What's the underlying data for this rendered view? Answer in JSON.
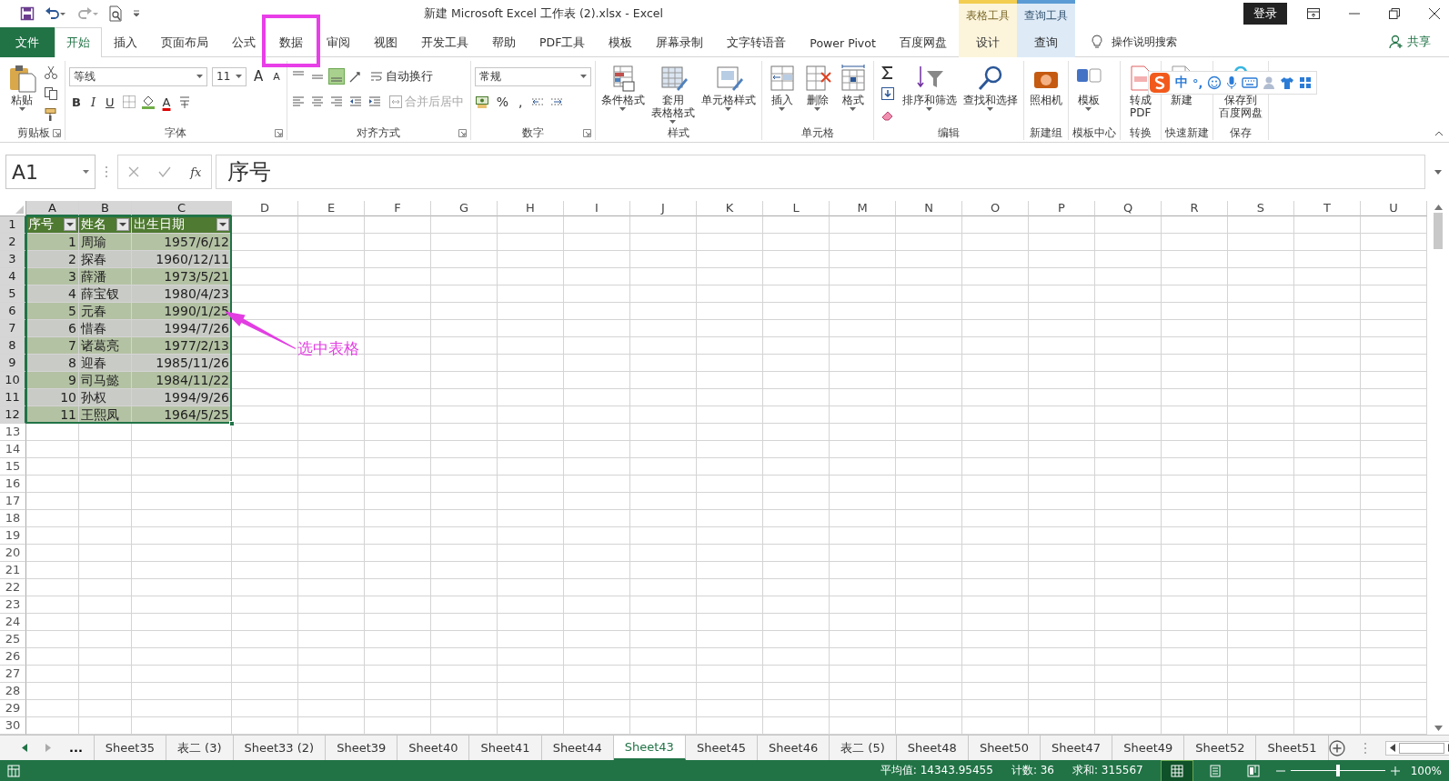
{
  "title_bar": {
    "title": "新建 Microsoft Excel 工作表 (2).xlsx  -  Excel",
    "context_headers": [
      {
        "label": "表格工具",
        "color": "#f2cd4f"
      },
      {
        "label": "查询工具",
        "color": "#5b9bd5"
      }
    ],
    "login": "登录"
  },
  "tabs": [
    {
      "label": "文件",
      "kind": "file",
      "selected": false,
      "highlight": false
    },
    {
      "label": "开始",
      "kind": "normal",
      "selected": true,
      "highlight": false
    },
    {
      "label": "插入",
      "kind": "normal",
      "selected": false,
      "highlight": false
    },
    {
      "label": "页面布局",
      "kind": "normal",
      "selected": false,
      "highlight": false
    },
    {
      "label": "公式",
      "kind": "normal",
      "selected": false,
      "highlight": false
    },
    {
      "label": "数据",
      "kind": "normal",
      "selected": false,
      "highlight": true
    },
    {
      "label": "审阅",
      "kind": "normal",
      "selected": false,
      "highlight": false
    },
    {
      "label": "视图",
      "kind": "normal",
      "selected": false,
      "highlight": false
    },
    {
      "label": "开发工具",
      "kind": "normal",
      "selected": false,
      "highlight": false
    },
    {
      "label": "帮助",
      "kind": "normal",
      "selected": false,
      "highlight": false
    },
    {
      "label": "PDF工具",
      "kind": "normal",
      "selected": false,
      "highlight": false
    },
    {
      "label": "模板",
      "kind": "normal",
      "selected": false,
      "highlight": false
    },
    {
      "label": "屏幕录制",
      "kind": "normal",
      "selected": false,
      "highlight": false
    },
    {
      "label": "文字转语音",
      "kind": "normal",
      "selected": false,
      "highlight": false
    },
    {
      "label": "Power Pivot",
      "kind": "normal",
      "selected": false,
      "highlight": false
    },
    {
      "label": "百度网盘",
      "kind": "normal",
      "selected": false,
      "highlight": false
    },
    {
      "label": "设计",
      "kind": "context",
      "selected": false,
      "highlight": false
    },
    {
      "label": "查询",
      "kind": "context",
      "selected": false,
      "highlight": false
    }
  ],
  "tell_me": "操作说明搜索",
  "share": "共享",
  "ribbon": {
    "groups": [
      {
        "label": "剪贴板",
        "launcher": true,
        "blocks": [
          {
            "kind": "large",
            "label": "粘贴",
            "caret": true
          },
          {
            "kind": "stack",
            "items": [
              {
                "kind": "icon"
              },
              {
                "kind": "icon"
              },
              {
                "kind": "icon"
              }
            ]
          }
        ]
      },
      {
        "label": "字体",
        "launcher": true,
        "blocks": [
          {
            "kind": "twoline",
            "top": [
              {
                "kind": "combo",
                "value": "等线"
              },
              {
                "kind": "combo",
                "value": "11"
              },
              {
                "kind": "grow",
                "label": "A"
              },
              {
                "kind": "shrink",
                "label": "A"
              }
            ],
            "bottom": [
              {
                "kind": "bold",
                "label": "B"
              },
              {
                "kind": "italic",
                "label": "I"
              },
              {
                "kind": "underline",
                "label": "U"
              },
              {
                "kind": "icon"
              },
              {
                "kind": "icon"
              },
              {
                "kind": "fontcolor",
                "label": "A"
              },
              {
                "kind": "icon"
              }
            ]
          }
        ]
      },
      {
        "label": "对齐方式",
        "launcher": true,
        "blocks": [
          {
            "kind": "twoline",
            "top": [
              {
                "kind": "icon",
                "on": false
              },
              {
                "kind": "icon",
                "on": false
              },
              {
                "kind": "icon",
                "on": true
              },
              {
                "kind": "icon"
              },
              {
                "kind": "wrap",
                "label": "自动换行",
                "disabled": false
              }
            ],
            "bottom": [
              {
                "kind": "icon"
              },
              {
                "kind": "icon"
              },
              {
                "kind": "icon"
              },
              {
                "kind": "icon"
              },
              {
                "kind": "icon"
              },
              {
                "kind": "merge",
                "label": "合并后居中",
                "disabled": true
              }
            ]
          }
        ]
      },
      {
        "label": "数字",
        "launcher": true,
        "blocks": [
          {
            "kind": "twoline",
            "top": [
              {
                "kind": "combo",
                "value": "常规"
              }
            ],
            "bottom": [
              {
                "kind": "icon"
              },
              {
                "kind": "tool",
                "label": "%"
              },
              {
                "kind": "tool",
                "label": ","
              },
              {
                "kind": "icon"
              },
              {
                "kind": "icon"
              }
            ]
          }
        ]
      },
      {
        "label": "样式",
        "launcher": false,
        "blocks": [
          {
            "kind": "large",
            "label": "条件格式",
            "caret": true
          },
          {
            "kind": "large",
            "lines": [
              "套用",
              "表格格式"
            ],
            "caret": true
          },
          {
            "kind": "large",
            "label": "单元格样式",
            "caret": true
          }
        ]
      },
      {
        "label": "单元格",
        "launcher": false,
        "blocks": [
          {
            "kind": "large",
            "label": "插入",
            "caret": true
          },
          {
            "kind": "large",
            "label": "删除",
            "caret": true
          },
          {
            "kind": "large",
            "label": "格式",
            "caret": true
          }
        ]
      },
      {
        "label": "编辑",
        "launcher": false,
        "blocks": [
          {
            "kind": "stack",
            "items": [
              {
                "kind": "icon"
              },
              {
                "kind": "icon"
              },
              {
                "kind": "icon"
              }
            ]
          },
          {
            "kind": "large",
            "label": "排序和筛选",
            "caret": true
          },
          {
            "kind": "large",
            "label": "查找和选择",
            "caret": true
          }
        ]
      },
      {
        "label": "新建组",
        "launcher": false,
        "blocks": [
          {
            "kind": "large",
            "label": "照相机",
            "caret": false
          }
        ]
      },
      {
        "label": "模板中心",
        "launcher": false,
        "blocks": [
          {
            "kind": "large",
            "label": "模板",
            "caret": true
          }
        ]
      },
      {
        "label": "转换",
        "launcher": false,
        "blocks": [
          {
            "kind": "large",
            "lines": [
              "转成",
              "PDF"
            ],
            "caret": false
          }
        ]
      },
      {
        "label": "快速新建",
        "launcher": false,
        "blocks": [
          {
            "kind": "large",
            "label": "新建",
            "caret": false
          }
        ]
      },
      {
        "label": "保存",
        "launcher": false,
        "blocks": [
          {
            "kind": "large",
            "lines": [
              "保存到",
              "百度网盘"
            ],
            "caret": false
          }
        ]
      }
    ]
  },
  "ime_toolbar": {
    "mode": "中",
    "punctuation": "°,"
  },
  "formula_bar": {
    "name_box": "A1",
    "function_label": "fx",
    "formula": "序号"
  },
  "columns": [
    {
      "label": "A",
      "selected": true
    },
    {
      "label": "B",
      "selected": true
    },
    {
      "label": "C",
      "selected": true
    },
    {
      "label": "D",
      "selected": false
    },
    {
      "label": "E",
      "selected": false
    },
    {
      "label": "F",
      "selected": false
    },
    {
      "label": "G",
      "selected": false
    },
    {
      "label": "H",
      "selected": false
    },
    {
      "label": "I",
      "selected": false
    },
    {
      "label": "J",
      "selected": false
    },
    {
      "label": "K",
      "selected": false
    },
    {
      "label": "L",
      "selected": false
    },
    {
      "label": "M",
      "selected": false
    },
    {
      "label": "N",
      "selected": false
    },
    {
      "label": "O",
      "selected": false
    },
    {
      "label": "P",
      "selected": false
    },
    {
      "label": "Q",
      "selected": false
    },
    {
      "label": "R",
      "selected": false
    },
    {
      "label": "S",
      "selected": false
    },
    {
      "label": "T",
      "selected": false
    },
    {
      "label": "U",
      "selected": false
    }
  ],
  "row_headers": [
    {
      "label": "1",
      "selected": true
    },
    {
      "label": "2",
      "selected": true
    },
    {
      "label": "3",
      "selected": true
    },
    {
      "label": "4",
      "selected": true
    },
    {
      "label": "5",
      "selected": true
    },
    {
      "label": "6",
      "selected": true
    },
    {
      "label": "7",
      "selected": true
    },
    {
      "label": "8",
      "selected": true
    },
    {
      "label": "9",
      "selected": true
    },
    {
      "label": "10",
      "selected": true
    },
    {
      "label": "11",
      "selected": true
    },
    {
      "label": "12",
      "selected": true
    },
    {
      "label": "13",
      "selected": false
    },
    {
      "label": "14",
      "selected": false
    },
    {
      "label": "15",
      "selected": false
    },
    {
      "label": "16",
      "selected": false
    },
    {
      "label": "17",
      "selected": false
    },
    {
      "label": "18",
      "selected": false
    },
    {
      "label": "19",
      "selected": false
    },
    {
      "label": "20",
      "selected": false
    },
    {
      "label": "21",
      "selected": false
    },
    {
      "label": "22",
      "selected": false
    },
    {
      "label": "23",
      "selected": false
    },
    {
      "label": "24",
      "selected": false
    },
    {
      "label": "25",
      "selected": false
    },
    {
      "label": "26",
      "selected": false
    },
    {
      "label": "27",
      "selected": false
    },
    {
      "label": "28",
      "selected": false
    },
    {
      "label": "29",
      "selected": false
    },
    {
      "label": "30",
      "selected": false
    }
  ],
  "table": {
    "selected": true,
    "headers": [
      {
        "label": "序号"
      },
      {
        "label": "姓名"
      },
      {
        "label": "出生日期"
      }
    ],
    "rows": [
      {
        "cells": [
          "1",
          "周瑜",
          "1957/6/12"
        ]
      },
      {
        "cells": [
          "2",
          "探春",
          "1960/12/11"
        ]
      },
      {
        "cells": [
          "3",
          "薛潘",
          "1973/5/21"
        ]
      },
      {
        "cells": [
          "4",
          "薛宝钗",
          "1980/4/23"
        ]
      },
      {
        "cells": [
          "5",
          "元春",
          "1990/1/25"
        ],
        "callout": "选中表格"
      },
      {
        "cells": [
          "6",
          "惜春",
          "1994/7/26"
        ]
      },
      {
        "cells": [
          "7",
          "诸葛亮",
          "1977/2/13"
        ]
      },
      {
        "cells": [
          "8",
          "迎春",
          "1985/11/26"
        ]
      },
      {
        "cells": [
          "9",
          "司马懿",
          "1984/11/22"
        ]
      },
      {
        "cells": [
          "10",
          "孙权",
          "1994/9/26"
        ]
      },
      {
        "cells": [
          "11",
          "王熙凤",
          "1964/5/25"
        ]
      }
    ]
  },
  "sheet_nav_more": "...",
  "sheet_tabs": [
    {
      "label": "Sheet35",
      "selected": false
    },
    {
      "label": "表二 (3)",
      "selected": false
    },
    {
      "label": "Sheet33 (2)",
      "selected": false
    },
    {
      "label": "Sheet39",
      "selected": false
    },
    {
      "label": "Sheet40",
      "selected": false
    },
    {
      "label": "Sheet41",
      "selected": false
    },
    {
      "label": "Sheet44",
      "selected": false
    },
    {
      "label": "Sheet43",
      "selected": true
    },
    {
      "label": "Sheet45",
      "selected": false
    },
    {
      "label": "Sheet46",
      "selected": false
    },
    {
      "label": "表二 (5)",
      "selected": false
    },
    {
      "label": "Sheet48",
      "selected": false
    },
    {
      "label": "Sheet50",
      "selected": false
    },
    {
      "label": "Sheet47",
      "selected": false
    },
    {
      "label": "Sheet49",
      "selected": false
    },
    {
      "label": "Sheet52",
      "selected": false
    },
    {
      "label": "Sheet51",
      "selected": false
    }
  ],
  "status_bar": {
    "stats": [
      "平均值: 14343.95455",
      "计数: 36",
      "求和: 315567"
    ],
    "views": [
      {
        "selected": true
      },
      {
        "selected": false
      },
      {
        "selected": false
      }
    ],
    "zoom": {
      "level": 0.5,
      "label": "100%"
    }
  }
}
